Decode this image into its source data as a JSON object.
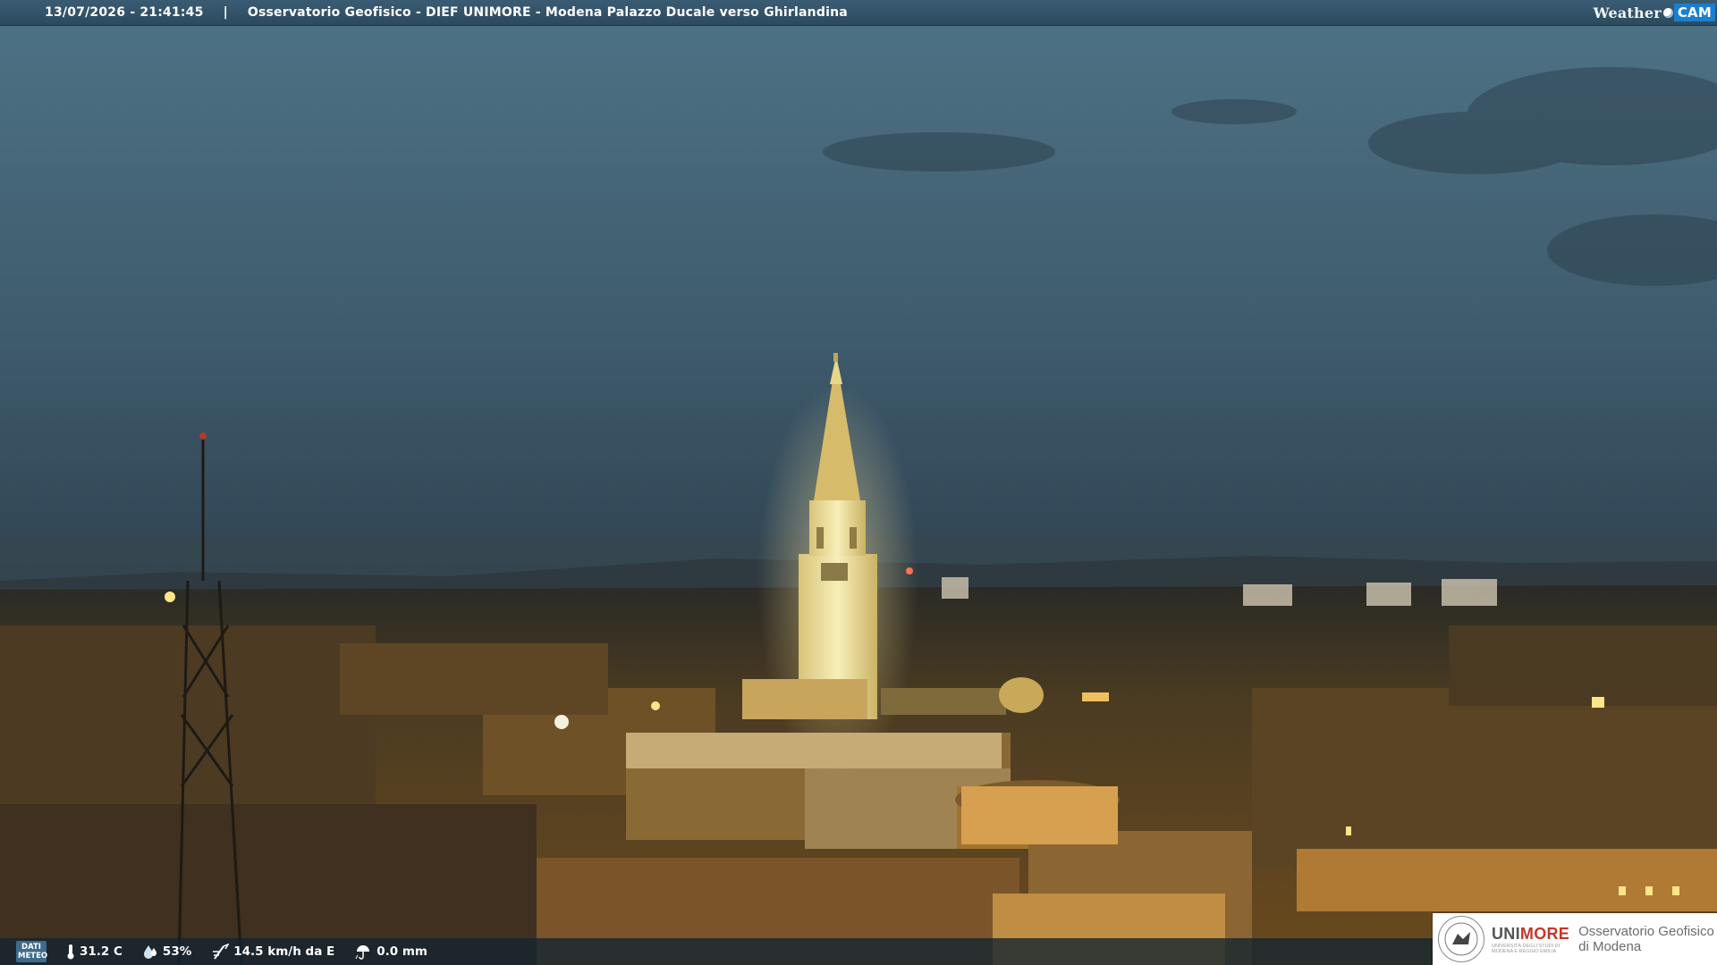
{
  "header": {
    "timestamp": "13/07/2026 - 21:41:45",
    "separator": "|",
    "title": "Osservatorio Geofisico - DIEF UNIMORE - Modena Palazzo Ducale verso Ghirlandina",
    "brand_weather": "Weather",
    "brand_cam": "CAM"
  },
  "weather": {
    "badge_line1": "DATI",
    "badge_line2": "METEO",
    "temperature": "31.2 C",
    "humidity": "53%",
    "wind": "14.5 km/h da E",
    "rain": "0.0 mm",
    "icons": [
      "thermometer-icon",
      "humidity-icon",
      "wind-icon",
      "rain-icon"
    ]
  },
  "footer_logo": {
    "uni_part1": "UNI",
    "uni_part2": "MORE",
    "uni_subtitle": "UNIVERSITÀ DEGLI STUDI DI MODENA E REGGIO EMILIA",
    "observatory_line1": "Osservatorio Geofisico",
    "observatory_line2": "di Modena"
  },
  "colors": {
    "sky_top": "#4f7488",
    "sky_bottom": "#2c3d4a",
    "city_light": "#c9932f",
    "tower_light": "#f3e9a8",
    "brand_blue": "#1a7fd0",
    "unimore_red": "#c0392b"
  }
}
